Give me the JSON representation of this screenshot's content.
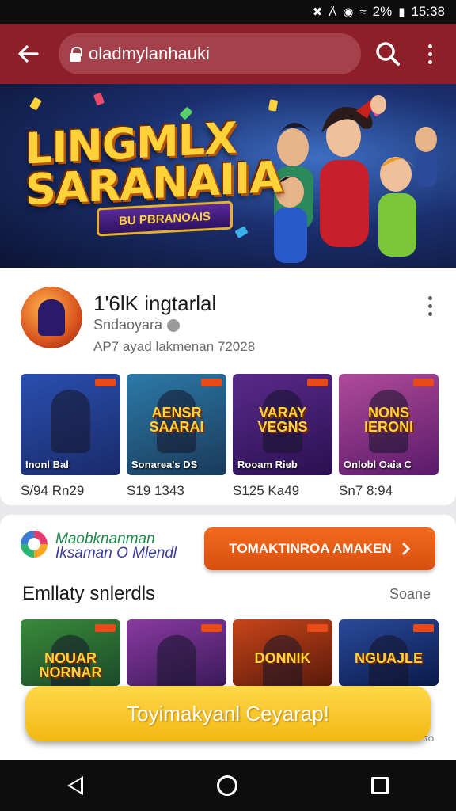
{
  "status_bar": {
    "battery_text": "2%",
    "time": "15:38"
  },
  "toolbar": {
    "url": "oladmylanhauki"
  },
  "hero": {
    "title_line1": "LINGMLX",
    "title_line2": "SARANAIIA",
    "subtitle": "BU PBRANOAIS"
  },
  "app": {
    "name": "1'6lK ingtarlal",
    "developer": "Sndaoyara",
    "meta": "AP7 ayad lakmenan 72028"
  },
  "top_tiles": [
    {
      "name": "Inonl Bal",
      "price": "S/94 Rn29",
      "art": "",
      "colors": [
        "#2a4fae",
        "#1a2a6a"
      ]
    },
    {
      "name": "Sonarea's  DS",
      "price": "S19 1343",
      "art": "AENSR SAARAI",
      "colors": [
        "#2c7aa8",
        "#1a3a5a"
      ]
    },
    {
      "name": "Rooam Rieb",
      "price": "S125 Ka49",
      "art": "VARAY VEGNS",
      "colors": [
        "#5a2a8a",
        "#2a1050"
      ]
    },
    {
      "name": "Onlobl Oaia C",
      "price": "Sn7 8:94",
      "art": "NONS IERONI",
      "colors": [
        "#b04a9a",
        "#5a1a6a"
      ]
    }
  ],
  "promo": {
    "brand_line1": "Maobknanman",
    "brand_line2": "Iksaman O Mlendl",
    "cta_label": "TOMAKTINROA AMAKEN"
  },
  "section": {
    "title": "Emllaty snlerdls",
    "link": "Soane"
  },
  "bottom_tiles": [
    {
      "art": "NOUAR NORNAR",
      "colors": [
        "#3a8a3a",
        "#1a4a2a"
      ]
    },
    {
      "art": "",
      "colors": [
        "#8a3aa0",
        "#3a1a5a"
      ]
    },
    {
      "art": "DONNIK",
      "colors": [
        "#c8451a",
        "#5a1a0a"
      ]
    },
    {
      "art": "NGUAJLE",
      "colors": [
        "#2a4a9a",
        "#0a1a4a"
      ]
    }
  ],
  "bottom_cta": {
    "label": "Toyimakyanl Ceyarap!",
    "note": "7O"
  }
}
